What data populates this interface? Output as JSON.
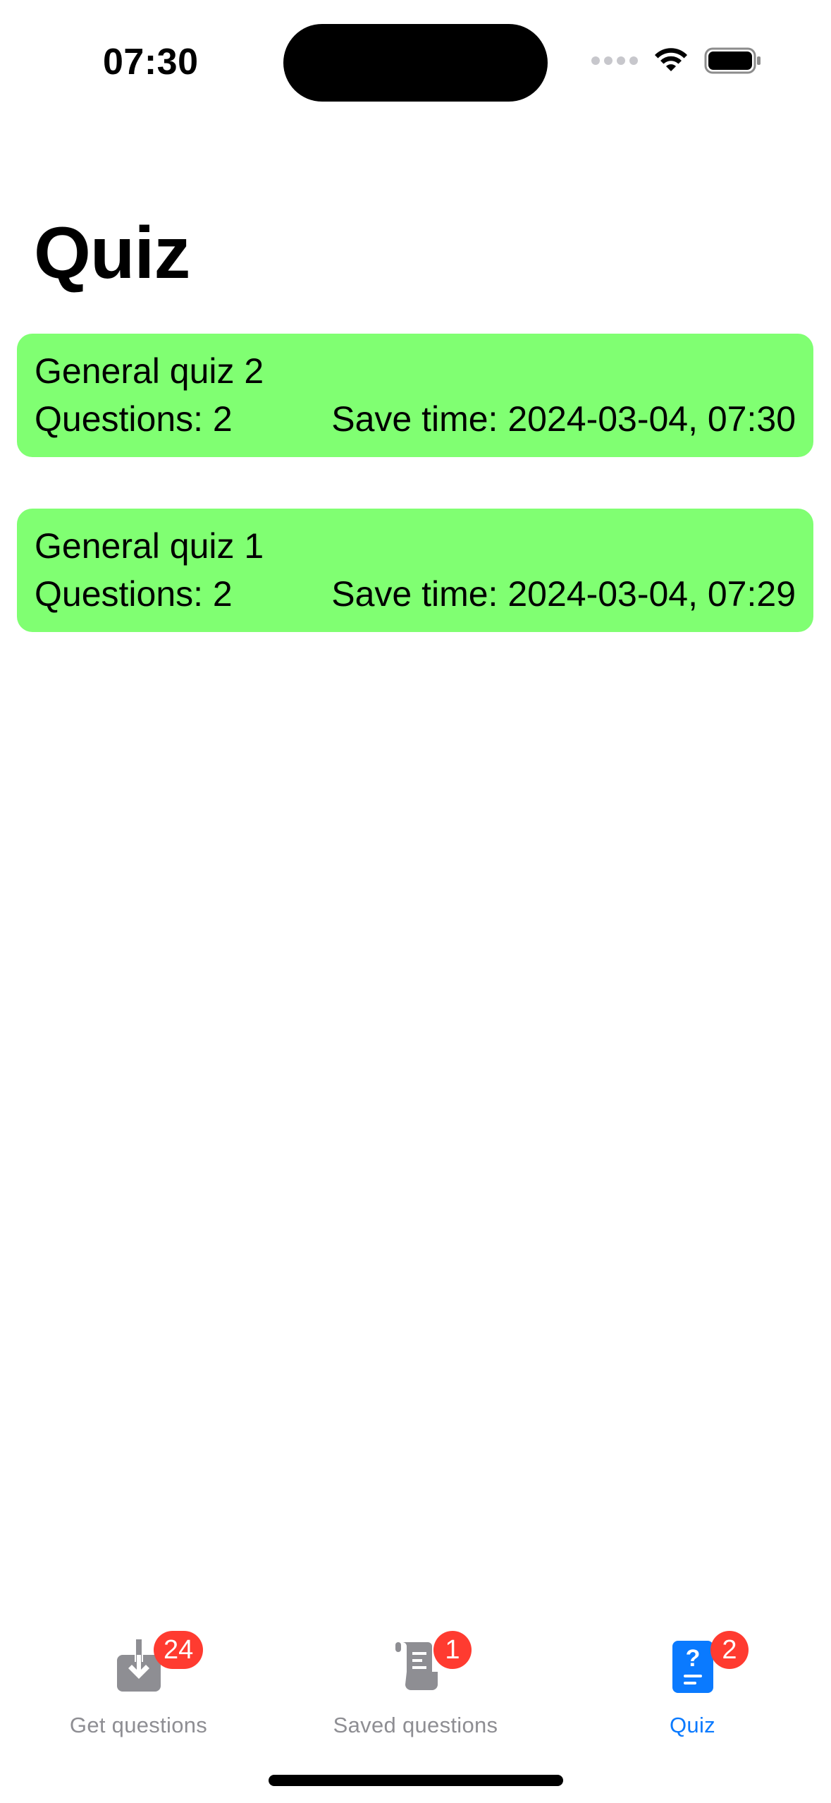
{
  "status_bar": {
    "time": "07:30"
  },
  "page": {
    "title": "Quiz"
  },
  "quizzes": [
    {
      "name": "General quiz 2",
      "questions": "Questions: 2",
      "save_time": "Save time: 2024-03-04, 07:30"
    },
    {
      "name": "General quiz 1",
      "questions": "Questions: 2",
      "save_time": "Save time: 2024-03-04, 07:29"
    }
  ],
  "tabbar": {
    "tabs": [
      {
        "label": "Get questions",
        "badge": "24",
        "icon": "download-icon",
        "selected": false
      },
      {
        "label": "Saved questions",
        "badge": "1",
        "icon": "scroll-icon",
        "selected": false
      },
      {
        "label": "Quiz",
        "badge": "2",
        "icon": "quiz-icon",
        "selected": true
      }
    ]
  },
  "colors": {
    "card_background": "#80ff72",
    "accent": "#0a7aff",
    "badge": "#ff3b30",
    "inactive_tab": "#8e8e93"
  }
}
